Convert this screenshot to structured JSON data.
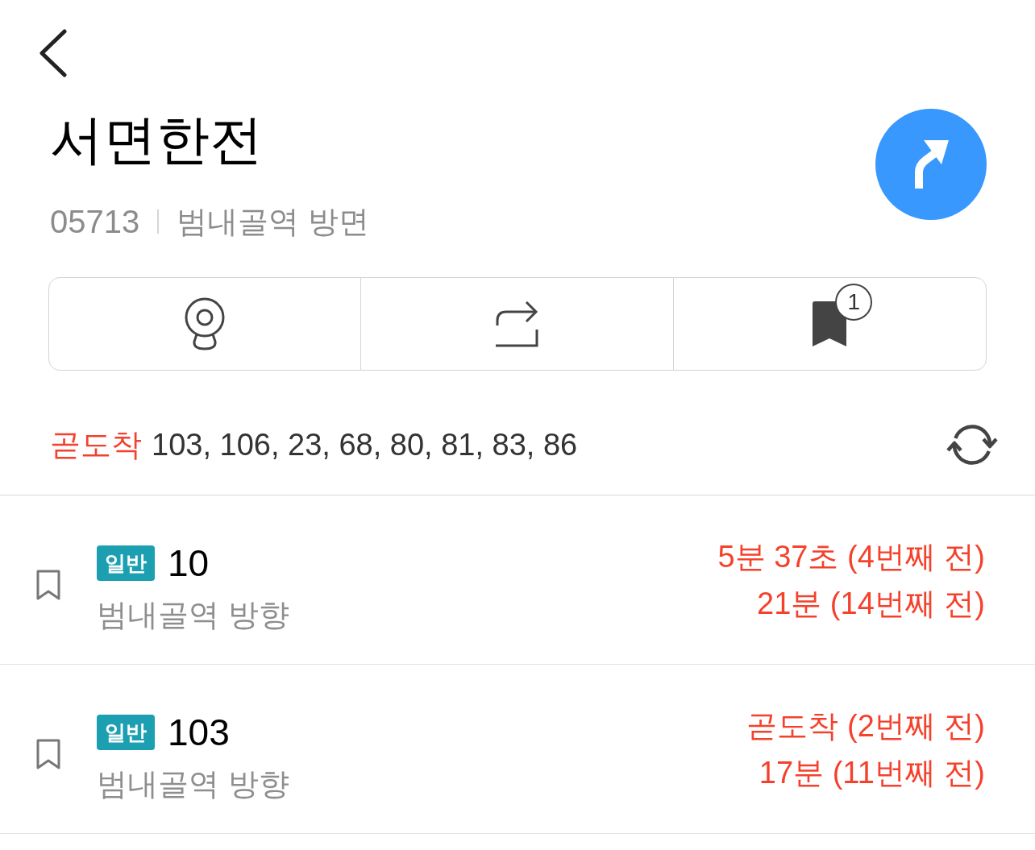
{
  "stop": {
    "name": "서면한전",
    "number": "05713",
    "direction": "범내골역 방면"
  },
  "action_bar": {
    "bookmark_count": "1"
  },
  "arriving_soon": {
    "label": "곧도착",
    "routes": "103, 106, 23, 68, 80, 81, 83, 86"
  },
  "routes": [
    {
      "bookmarked": false,
      "type_badge": "일반",
      "number": "10",
      "direction": "범내골역 방향",
      "arrivals": [
        "5분 37초 (4번째 전)",
        "21분 (14번째 전)"
      ]
    },
    {
      "bookmarked": false,
      "type_badge": "일반",
      "number": "103",
      "direction": "범내골역 방향",
      "arrivals": [
        "곧도착 (2번째 전)",
        "17분 (11번째 전)"
      ]
    }
  ]
}
